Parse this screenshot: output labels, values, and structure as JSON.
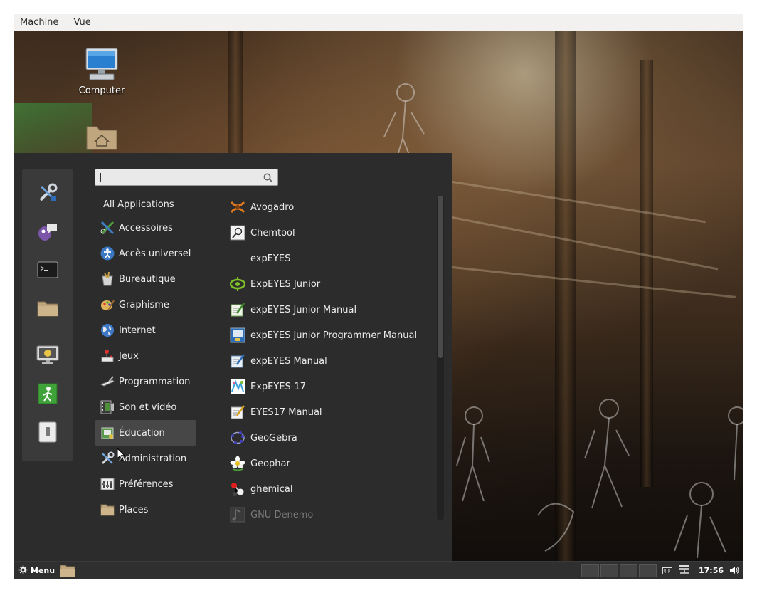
{
  "menubar": {
    "items": [
      "Machine",
      "Vue"
    ]
  },
  "desktop": {
    "icons": [
      {
        "label": "Computer",
        "icon": "computer-icon"
      },
      {
        "label": "",
        "icon": "home-folder-icon"
      }
    ]
  },
  "menu": {
    "search": {
      "value": "",
      "placeholder": ""
    },
    "favorites": [
      {
        "icon": "settings-tools-icon"
      },
      {
        "icon": "pidgin-chat-icon"
      },
      {
        "icon": "terminal-icon"
      },
      {
        "icon": "folder-icon"
      },
      {
        "icon": "lock-screen-icon"
      },
      {
        "icon": "logout-icon"
      },
      {
        "icon": "shutdown-icon"
      }
    ],
    "categories": [
      {
        "label": "All Applications",
        "icon": ""
      },
      {
        "label": "Accessoires",
        "icon": "accessories-icon"
      },
      {
        "label": "Accès universel",
        "icon": "accessibility-icon"
      },
      {
        "label": "Bureautique",
        "icon": "office-icon"
      },
      {
        "label": "Graphisme",
        "icon": "graphics-icon"
      },
      {
        "label": "Internet",
        "icon": "internet-globe-icon"
      },
      {
        "label": "Jeux",
        "icon": "games-joystick-icon"
      },
      {
        "label": "Programmation",
        "icon": "programming-icon"
      },
      {
        "label": "Son et vidéo",
        "icon": "multimedia-icon"
      },
      {
        "label": "Éducation",
        "icon": "education-icon",
        "active": true
      },
      {
        "label": "Administration",
        "icon": "administration-icon"
      },
      {
        "label": "Préférences",
        "icon": "preferences-icon"
      },
      {
        "label": "Places",
        "icon": "places-folder-icon"
      }
    ],
    "apps": [
      {
        "label": "Avogadro",
        "icon": "avogadro-icon"
      },
      {
        "label": "Chemtool",
        "icon": "chemtool-icon"
      },
      {
        "label": "expEYES",
        "icon": ""
      },
      {
        "label": "ExpEYES Junior",
        "icon": "expeyes-eye-icon"
      },
      {
        "label": "expEYES Junior Manual",
        "icon": "manual-icon"
      },
      {
        "label": "expEYES Junior Programmer Manual",
        "icon": "programmer-manual-icon"
      },
      {
        "label": "expEYES Manual",
        "icon": "manual-icon"
      },
      {
        "label": "ExpEYES-17",
        "icon": "expeyes17-icon"
      },
      {
        "label": "EYES17 Manual",
        "icon": "manual-icon"
      },
      {
        "label": "GeoGebra",
        "icon": "geogebra-icon"
      },
      {
        "label": "Geophar",
        "icon": "geophar-flower-icon"
      },
      {
        "label": "ghemical",
        "icon": "ghemical-molecule-icon"
      },
      {
        "label": "GNU Denemo",
        "icon": "denemo-icon",
        "dim": true
      }
    ]
  },
  "taskbar": {
    "menu_label": "Menu",
    "clock": "17:56",
    "workspaces": 4
  }
}
